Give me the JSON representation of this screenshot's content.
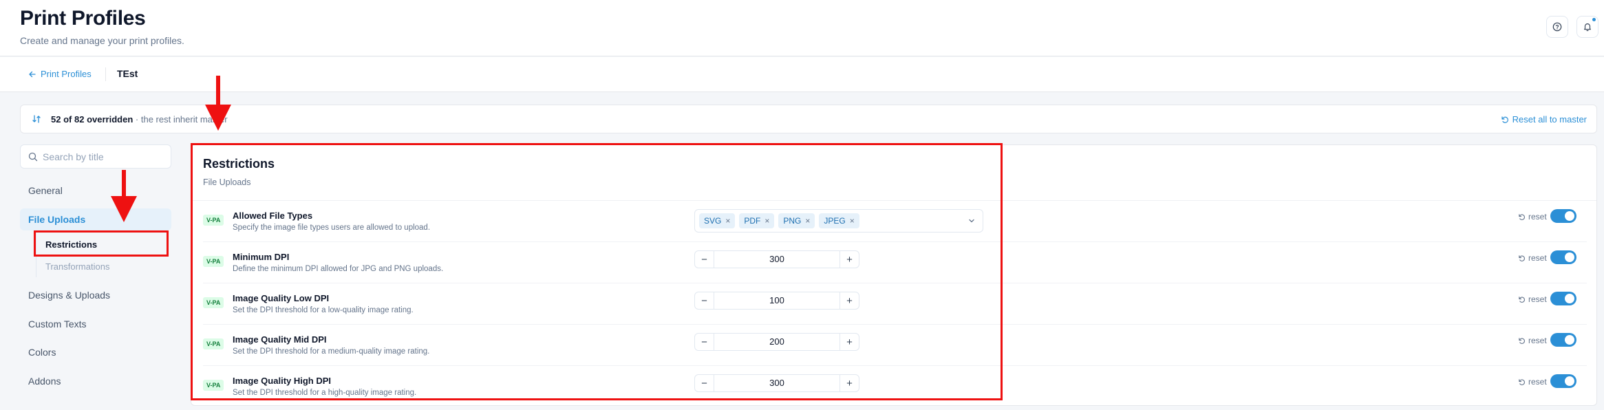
{
  "header": {
    "title": "Print Profiles",
    "subtitle": "Create and manage your print profiles.",
    "help_icon": "help-circle-icon",
    "notification_icon": "bell-icon"
  },
  "breadcrumb": {
    "back_label": "Print Profiles",
    "current": "TEst"
  },
  "override_summary": {
    "count": "52",
    "of_label": "of",
    "total": "82",
    "overridden_label": "overridden",
    "rest_label": "· the rest inherit master",
    "reset_all_label": "Reset all to master"
  },
  "sidebar": {
    "search_placeholder": "Search by title",
    "items": [
      {
        "label": "General"
      },
      {
        "label": "File Uploads"
      },
      {
        "label": "Designs & Uploads"
      },
      {
        "label": "Custom Texts"
      },
      {
        "label": "Colors"
      },
      {
        "label": "Addons"
      }
    ],
    "sub_items": [
      {
        "label": "Restrictions"
      },
      {
        "label": "Transformations"
      }
    ]
  },
  "panel": {
    "title": "Restrictions",
    "subtitle": "File Uploads",
    "rows": [
      {
        "badge": "V-PA",
        "title": "Allowed File Types",
        "desc": "Specify the image file types users are allowed to upload.",
        "chips": [
          "SVG",
          "PDF",
          "PNG",
          "JPEG"
        ],
        "reset_label": "reset",
        "enabled": true
      },
      {
        "badge": "V-PA",
        "title": "Minimum DPI",
        "desc": "Define the minimum DPI allowed for JPG and PNG uploads.",
        "value": "300",
        "reset_label": "reset",
        "enabled": true
      },
      {
        "badge": "V-PA",
        "title": "Image Quality Low DPI",
        "desc": "Set the DPI threshold for a low-quality image rating.",
        "value": "100",
        "reset_label": "reset",
        "enabled": true
      },
      {
        "badge": "V-PA",
        "title": "Image Quality Mid DPI",
        "desc": "Set the DPI threshold for a medium-quality image rating.",
        "value": "200",
        "reset_label": "reset",
        "enabled": true
      },
      {
        "badge": "V-PA",
        "title": "Image Quality High DPI",
        "desc": "Set the DPI threshold for a high-quality image rating.",
        "value": "300",
        "reset_label": "reset",
        "enabled": true
      }
    ]
  },
  "colors": {
    "accent": "#2b8fd6",
    "badge_bg": "#dcfce7",
    "badge_text": "#15803d",
    "annotation": "#ee1111"
  }
}
